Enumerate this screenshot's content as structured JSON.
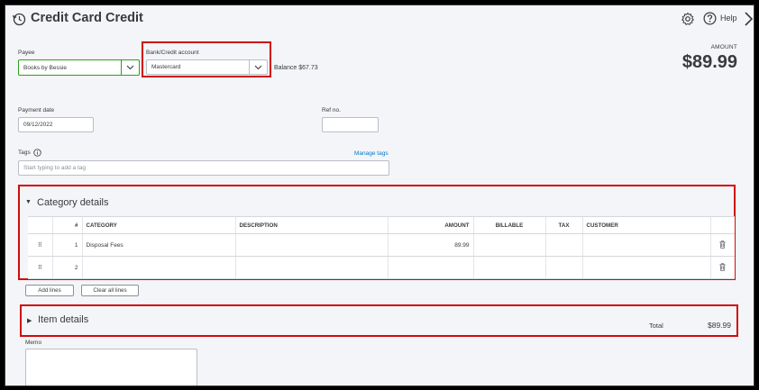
{
  "header": {
    "title": "Credit Card Credit",
    "help_label": "Help"
  },
  "payee": {
    "label": "Payee",
    "value": "Books by Bessie"
  },
  "account": {
    "label": "Bank/Credit account",
    "value": "Mastercard",
    "balance": "Balance $67.73"
  },
  "amount": {
    "label": "AMOUNT",
    "value": "$89.99"
  },
  "payment_date": {
    "label": "Payment date",
    "value": "09/12/2022"
  },
  "ref_no": {
    "label": "Ref no.",
    "value": ""
  },
  "tags": {
    "label": "Tags",
    "info_icon": "info-circle-icon",
    "manage_link": "Manage tags",
    "placeholder": "Start typing to add a tag"
  },
  "category_details": {
    "title": "Category details",
    "columns": [
      "",
      "#",
      "CATEGORY",
      "DESCRIPTION",
      "AMOUNT",
      "BILLABLE",
      "TAX",
      "CUSTOMER",
      ""
    ],
    "rows": [
      {
        "num": "1",
        "category": "Disposal Fees",
        "description": "",
        "amount": "89.99",
        "billable": "",
        "tax": "",
        "customer": ""
      },
      {
        "num": "2",
        "category": "",
        "description": "",
        "amount": "",
        "billable": "",
        "tax": "",
        "customer": ""
      }
    ],
    "add_lines": "Add lines",
    "clear_all_lines": "Clear all lines"
  },
  "item_details": {
    "title": "Item details",
    "total_label": "Total",
    "total_value": "$89.99"
  },
  "memo": {
    "label": "Memo",
    "value": ""
  },
  "colors": {
    "highlight": "#d10a0a",
    "link": "#0077c5",
    "active_border": "#2ca01c"
  }
}
